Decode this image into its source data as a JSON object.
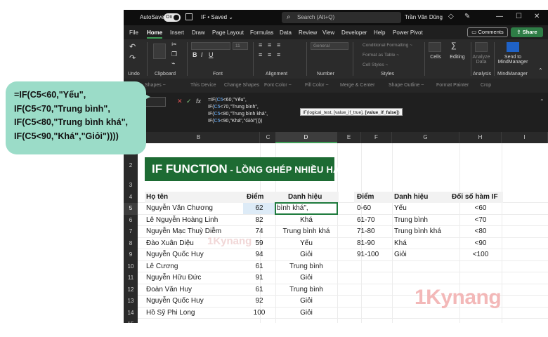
{
  "titlebar": {
    "autosave_label": "AutoSave",
    "autosave_state": "On",
    "doc_name": "IF • Saved ⌄",
    "search_placeholder": "Search (Alt+Q)",
    "user_name": "Trần Văn Dũng"
  },
  "menu": {
    "tabs": [
      "File",
      "Home",
      "Insert",
      "Draw",
      "Page Layout",
      "Formulas",
      "Data",
      "Review",
      "View",
      "Developer",
      "Help",
      "Power Pivot"
    ],
    "active_tab": "Home",
    "comments_label": "Comments",
    "share_label": "Share"
  },
  "ribbon": {
    "groups": [
      "Undo",
      "Clipboard",
      "Font",
      "Alignment",
      "Number",
      "Styles",
      "Cells",
      "Editing",
      "Analysis",
      "MindManager"
    ],
    "font_size": "11",
    "number_format": "General",
    "conditional_formatting": "Conditional Formatting ~",
    "format_as_table": "Format as Table ~",
    "cell_styles": "Cell Styles ~",
    "cells_label": "Cells",
    "editing_label": "Editing",
    "analyze_data_label": "Analyze Data",
    "send_to_label": "Send to MindManager"
  },
  "drawbar": {
    "items": [
      "Shapes ~",
      "This Device",
      "Change Shapes",
      "Font Color ~",
      "Fill Color ~",
      "Merge & Center",
      "Shape Outline ~",
      "Format Painter",
      "Crop"
    ]
  },
  "formula_bar": {
    "lines": [
      [
        "=IF(",
        "C5",
        "<60,\"Yếu\","
      ],
      [
        "IF(",
        "C5",
        "<70,\"Trung bình\","
      ],
      [
        "IF(",
        "C5",
        "<80,\"Trung bình khá\","
      ],
      [
        "IF(",
        "C5",
        "<90,\"Khá\",\"Giỏi\"))))"
      ]
    ],
    "tooltip_plain": "IF(logical_test, [value_if_true], ",
    "tooltip_bold": "[value_if_false]",
    "tooltip_end": ")"
  },
  "columns": [
    "B",
    "C",
    "D",
    "E",
    "F",
    "G",
    "H",
    "I"
  ],
  "rows": [
    "2",
    "3",
    "4",
    "5",
    "6",
    "7",
    "8",
    "9",
    "10",
    "11",
    "12",
    "13",
    "14",
    "15"
  ],
  "banner": {
    "part1": "IF FUNCTION",
    "part2": " - LỒNG GHÉP NHIỀU HÀM IF"
  },
  "left_table": {
    "headers": [
      "Họ tên",
      "Điểm",
      "Danh hiệu"
    ],
    "rows": [
      [
        "Nguyễn Văn Chương",
        "62",
        "bình khá\","
      ],
      [
        "Lê Nguyễn Hoàng Linh",
        "82",
        "Khá"
      ],
      [
        "Nguyễn Mạc Thuỳ Diễm",
        "74",
        "Trung bình khá"
      ],
      [
        "Đào Xuân Diệu",
        "59",
        "Yếu"
      ],
      [
        "Nguyễn Quốc Huy",
        "94",
        "Giỏi"
      ],
      [
        "Lê Cương",
        "61",
        "Trung bình"
      ],
      [
        "Nguyễn Hữu Đức",
        "91",
        "Giỏi"
      ],
      [
        "Đoàn Văn Huy",
        "61",
        "Trung bình"
      ],
      [
        "Nguyễn Quốc Huy",
        "92",
        "Giỏi"
      ],
      [
        "Hồ Sỹ Phi Long",
        "100",
        "Giỏi"
      ]
    ]
  },
  "right_table": {
    "headers": [
      "Điểm",
      "Danh hiệu",
      "Đối số hàm IF"
    ],
    "rows": [
      [
        "0-60",
        "Yếu",
        "<60"
      ],
      [
        "61-70",
        "Trung bình",
        "<70"
      ],
      [
        "71-80",
        "Trung bình khá",
        "<80"
      ],
      [
        "81-90",
        "Khá",
        "<90"
      ],
      [
        "91-100",
        "Giỏi",
        "<100"
      ]
    ]
  },
  "callout": {
    "lines": [
      "=IF(C5<60,\"Yếu\",",
      "IF(C5<70,\"Trung bình\",",
      "IF(C5<80,\"Trung bình khá\",",
      "IF(C5<90,\"Khá\",\"Giỏi\"))))"
    ]
  },
  "watermark": {
    "big": "1Kynang",
    "small": "1Kynang"
  },
  "colors": {
    "accent_green": "#1d6b33",
    "callout_bg": "#9bdcc8",
    "watermark": "#f3b8b8",
    "ref_blue": "#6fb5ff"
  }
}
